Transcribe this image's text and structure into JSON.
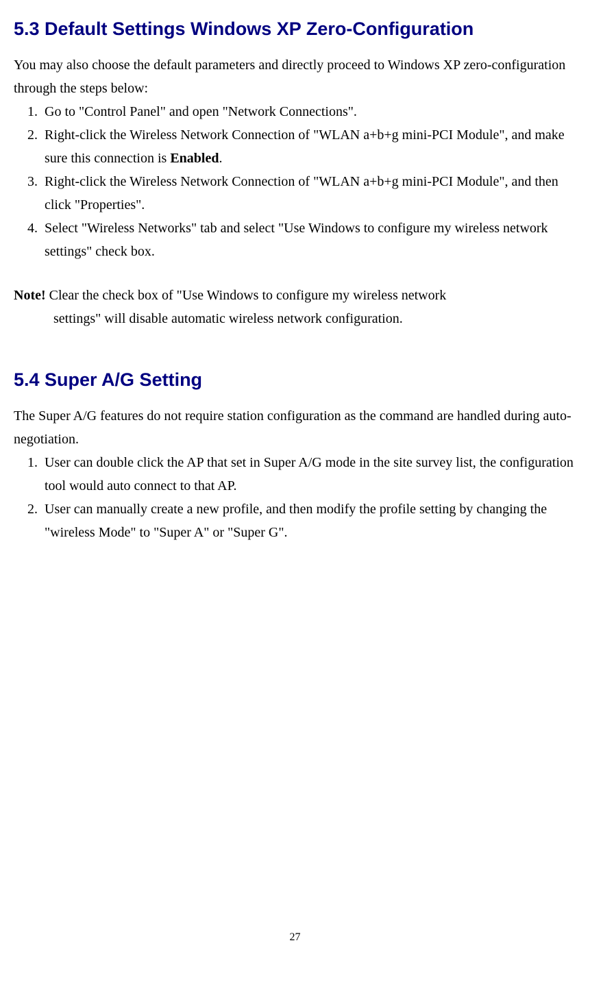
{
  "section53": {
    "heading": "5.3 Default Settings Windows XP Zero-Configuration",
    "intro": "You may also choose the default parameters and directly proceed to Windows XP zero-configuration through the steps below:",
    "steps": [
      "Go to \"Control Panel\" and open \"Network Connections\".",
      "Right-click the Wireless Network Connection of \"WLAN a+b+g mini-PCI Module\", and make sure this connection is ",
      "Right-click the Wireless Network Connection of \"WLAN a+b+g mini-PCI Module\", and then click \"Properties\".",
      "Select \"Wireless Networks\" tab and select \"Use Windows to configure my wireless network settings\" check box."
    ],
    "step2_bold": "Enabled",
    "step2_end": ".",
    "note_label": "Note!",
    "note_line1": " Clear the check box of \"Use Windows to configure my wireless network",
    "note_line2": "settings\" will disable automatic wireless network configuration."
  },
  "section54": {
    "heading": "5.4 Super A/G Setting",
    "intro": "The Super A/G features do not require station configuration as the command are handled during auto-negotiation.",
    "steps": [
      "User can double click the AP that set in Super A/G mode in the site survey list, the configuration tool would auto connect to that AP.",
      "User can manually create a new profile, and then modify the profile setting by changing the \"wireless Mode\" to \"Super A\" or \"Super G\"."
    ]
  },
  "page_number": "27"
}
